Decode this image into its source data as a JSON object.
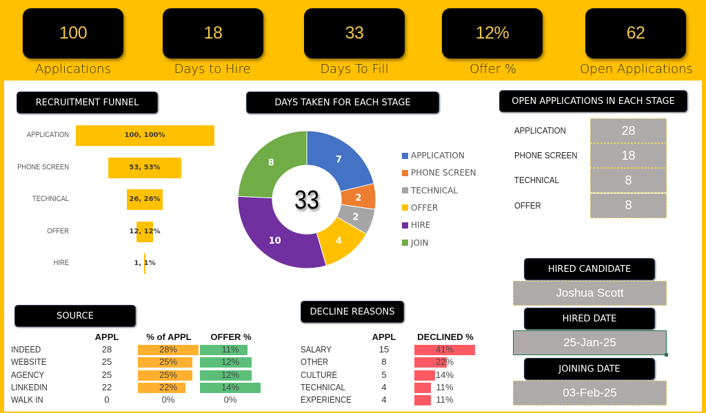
{
  "kpis": [
    {
      "value": "100",
      "label": "Applications"
    },
    {
      "value": "18",
      "label": "Days to Hire"
    },
    {
      "value": "33",
      "label": "Days To Fill"
    },
    {
      "value": "12%",
      "label": "Offer %"
    },
    {
      "value": "62",
      "label": "Open Applications"
    }
  ],
  "headers": {
    "funnel": "RECRUITMENT FUNNEL",
    "days": "DAYS TAKEN FOR EACH STAGE",
    "open": "OPEN APPLICATIONS IN EACH STAGE",
    "source": "SOURCE",
    "decline": "DECLINE REASONS",
    "hired_candidate": "HIRED CANDIDATE",
    "hired_date": "HIRED DATE",
    "joining_date": "JOINING DATE"
  },
  "colors": {
    "accent": "#ffc000",
    "panel": "#ffffff",
    "gray_cell": "#aeaaaa",
    "orange_bar": "#ffb02e",
    "green_bar": "#5bbf7a",
    "red_bar": "#ff5a64"
  },
  "chart_data": [
    {
      "type": "bar",
      "title": "RECRUITMENT FUNNEL",
      "orientation": "horizontal-funnel",
      "categories": [
        "APPLICATION",
        "PHONE SCREEN",
        "TECHNICAL",
        "OFFER",
        "HIRE"
      ],
      "values": [
        100,
        53,
        26,
        12,
        1
      ],
      "percents": [
        100,
        53,
        26,
        12,
        1
      ],
      "data_labels": [
        "100, 100%",
        "53, 53%",
        "26, 26%",
        "12, 12%",
        "1, 1%"
      ],
      "color": "#ffc000"
    },
    {
      "type": "pie",
      "subtype": "donut",
      "title": "DAYS TAKEN FOR EACH STAGE",
      "center_label": "33",
      "categories": [
        "APPLICATION",
        "PHONE SCREEN",
        "TECHNICAL",
        "OFFER",
        "HIRE",
        "JOIN"
      ],
      "values": [
        7,
        2,
        2,
        4,
        10,
        8
      ],
      "colors": [
        "#4472c4",
        "#ed7d31",
        "#a5a5a5",
        "#ffc000",
        "#7030a0",
        "#70ad47"
      ],
      "legend": "right"
    }
  ],
  "open_applications": [
    {
      "stage": "APPLICATION",
      "count": "28"
    },
    {
      "stage": "PHONE SCREEN",
      "count": "18"
    },
    {
      "stage": "TECHNICAL",
      "count": "8"
    },
    {
      "stage": "OFFER",
      "count": "8"
    }
  ],
  "hired": {
    "candidate": "Joshua Scott",
    "hired_date": "25-Jan-25",
    "joining_date": "03-Feb-25"
  },
  "source": {
    "columns": [
      "APPL",
      "% of APPL",
      "OFFER %"
    ],
    "rows": [
      {
        "name": "INDEED",
        "appl": "28",
        "pct": "28%",
        "pct_val": 28,
        "offer": "11%",
        "offer_val": 11
      },
      {
        "name": "WEBSITE",
        "appl": "25",
        "pct": "25%",
        "pct_val": 25,
        "offer": "12%",
        "offer_val": 12
      },
      {
        "name": "AGENCY",
        "appl": "25",
        "pct": "25%",
        "pct_val": 25,
        "offer": "12%",
        "offer_val": 12
      },
      {
        "name": "LINKEDIN",
        "appl": "22",
        "pct": "22%",
        "pct_val": 22,
        "offer": "14%",
        "offer_val": 14
      },
      {
        "name": "WALK IN",
        "appl": "0",
        "pct": "0%",
        "pct_val": 0,
        "offer": "0%",
        "offer_val": 0
      }
    ]
  },
  "decline": {
    "columns": [
      "APPL",
      "DECLINED %"
    ],
    "rows": [
      {
        "name": "SALARY",
        "appl": "15",
        "pct": "41%",
        "pct_val": 41
      },
      {
        "name": "OTHER",
        "appl": "8",
        "pct": "22%",
        "pct_val": 22
      },
      {
        "name": "CULTURE",
        "appl": "5",
        "pct": "14%",
        "pct_val": 14
      },
      {
        "name": "TECHNICAL",
        "appl": "4",
        "pct": "11%",
        "pct_val": 11
      },
      {
        "name": "EXPERIENCE",
        "appl": "4",
        "pct": "11%",
        "pct_val": 11
      }
    ]
  }
}
